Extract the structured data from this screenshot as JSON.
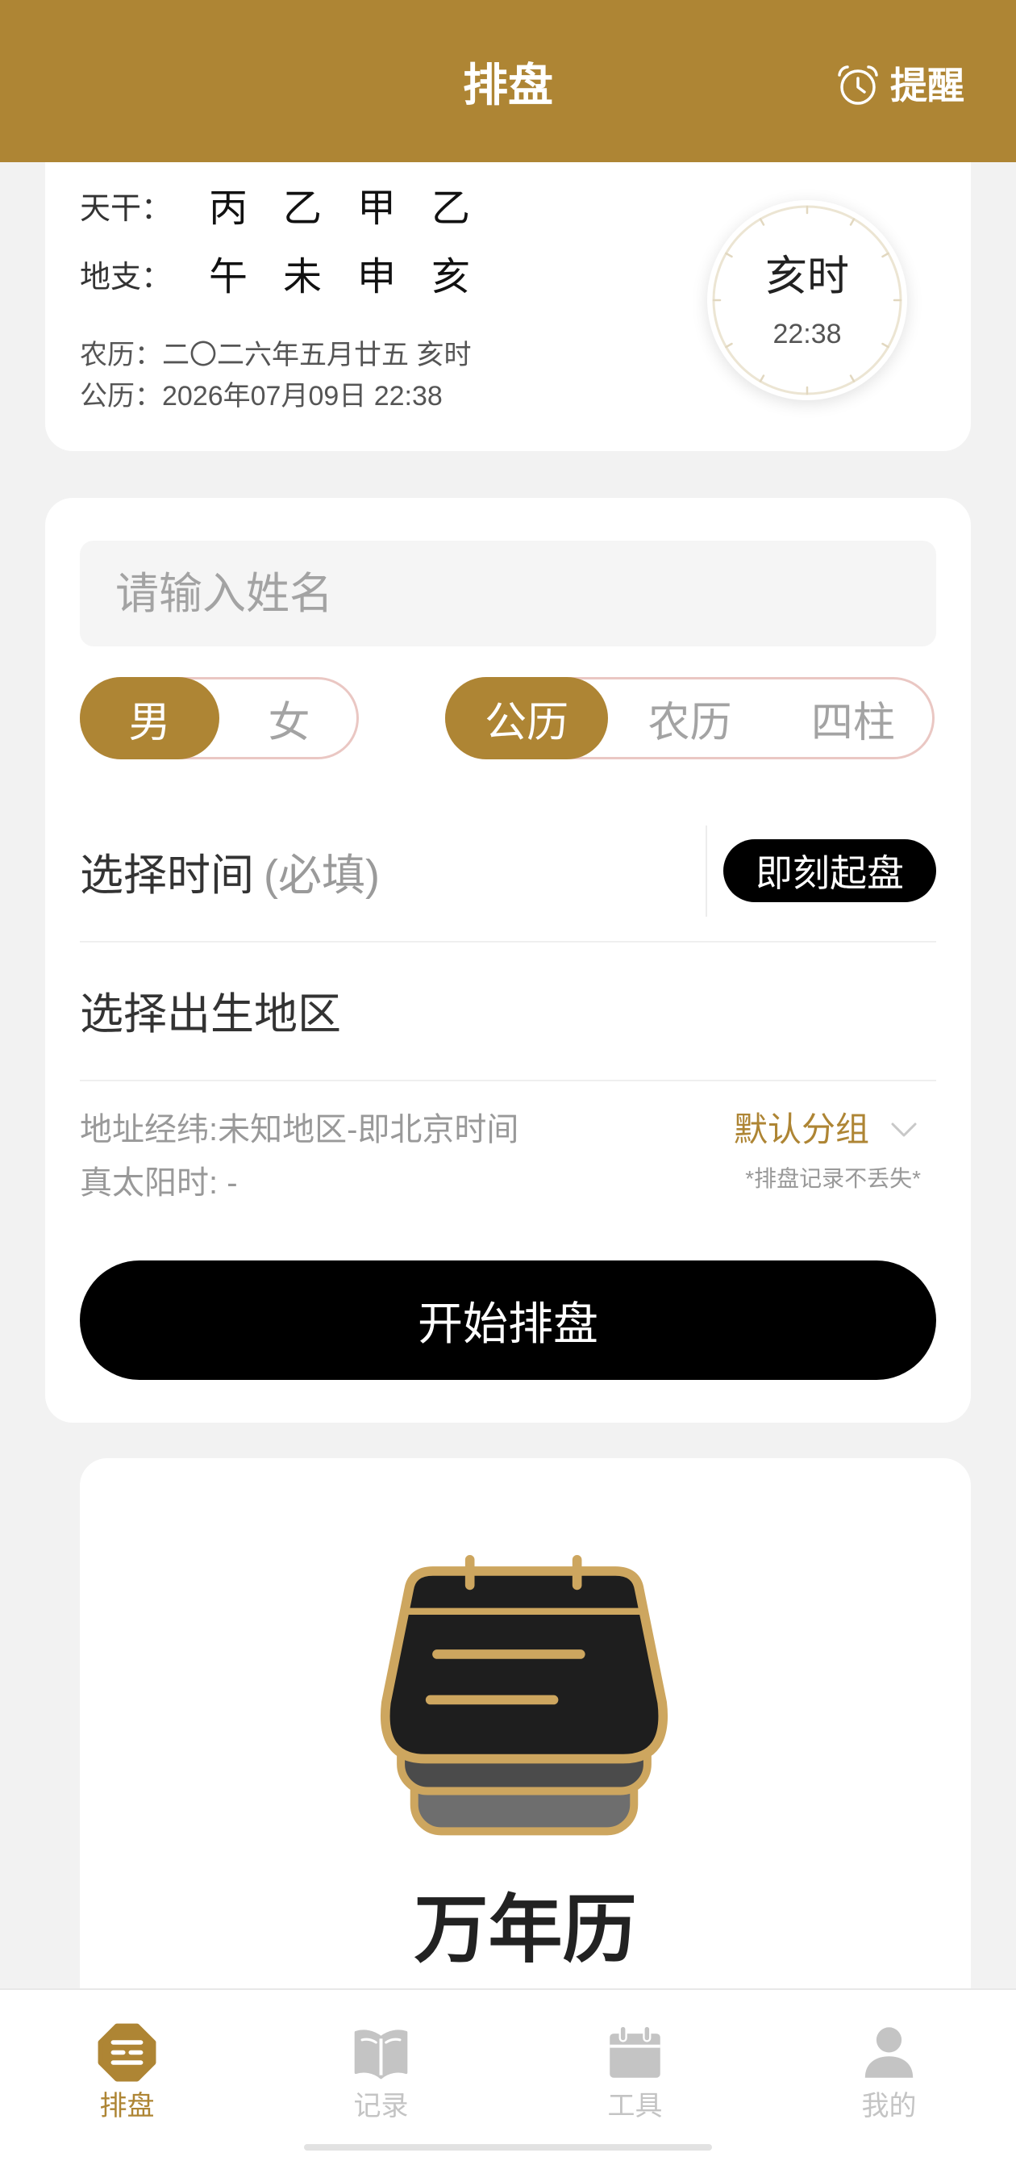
{
  "colors": {
    "brand": "#AE8534",
    "page_background": "#F2F2F2",
    "nav_inactive": "#C4C4C4",
    "toggle_border": "#EAC7C3",
    "button_dark": "#000000",
    "calendar_icon_gold": "#CDA65F"
  },
  "header": {
    "title": "排盘",
    "reminder_label": "提醒",
    "reminder_icon": "alarm-clock-icon"
  },
  "bazi_card": {
    "tiangan_label": "天干：",
    "tiangan": [
      "丙",
      "乙",
      "甲",
      "乙"
    ],
    "dizhi_label": "地支：",
    "dizhi": [
      "午",
      "未",
      "申",
      "亥"
    ],
    "lunar_date": "农历：二〇二六年五月廿五 亥时",
    "solar_date": "公历：2026年07月09日 22:38",
    "clock": {
      "shichen": "亥时",
      "time": "22:38"
    }
  },
  "form": {
    "name_placeholder": "请输入姓名",
    "name_value": "",
    "gender_options": [
      "男",
      "女"
    ],
    "gender_selected": "男",
    "calendar_options": [
      "公历",
      "农历",
      "四柱"
    ],
    "calendar_selected": "公历",
    "time_label": "选择时间",
    "time_required_hint": "(必填)",
    "instant_button": "即刻起盘",
    "region_label": "选择出生地区",
    "address_info": "地址经纬:未知地区-即北京时间",
    "true_solar_time": "真太阳时: -",
    "group_select": "默认分组",
    "group_select_icon": "chevron-down-icon",
    "group_note": "*排盘记录不丢失*",
    "start_button": "开始排盘"
  },
  "calendar_card": {
    "icon": "calendar-icon",
    "title": "万年历"
  },
  "bottom_nav": {
    "items": [
      {
        "label": "排盘",
        "icon": "bagua-icon",
        "active": true
      },
      {
        "label": "记录",
        "icon": "book-icon",
        "active": false
      },
      {
        "label": "工具",
        "icon": "calendar-icon",
        "active": false
      },
      {
        "label": "我的",
        "icon": "user-icon",
        "active": false
      }
    ]
  }
}
